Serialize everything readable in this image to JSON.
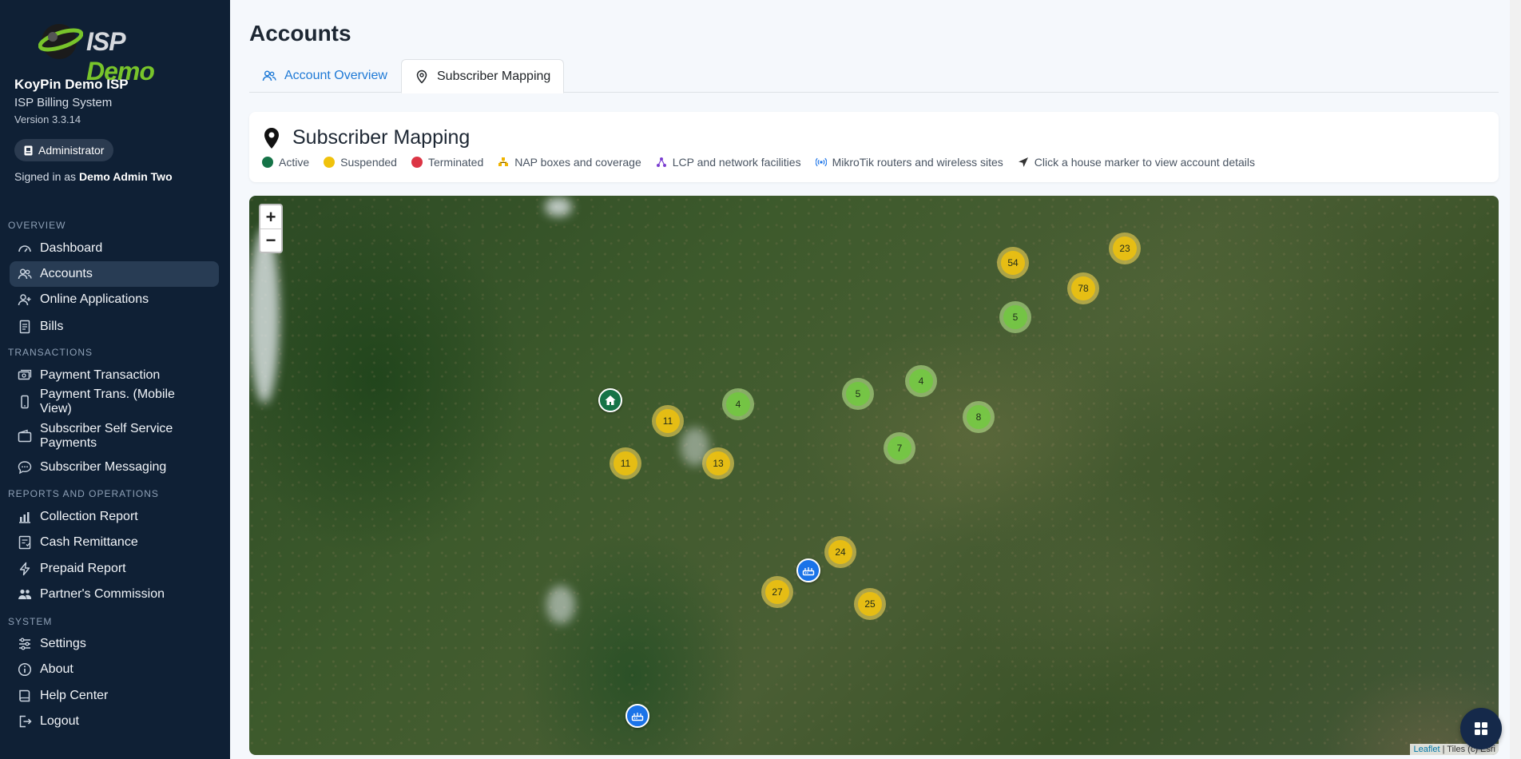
{
  "brand": {
    "logo_part1": "ISP",
    "logo_part2": "Demo"
  },
  "sidebar": {
    "org_name": "KoyPin Demo ISP",
    "system_name": "ISP Billing System",
    "version": "Version 3.3.14",
    "role": "Administrator",
    "signed_prefix": "Signed in as",
    "signed_user": "Demo Admin Two",
    "sections": {
      "overview": "OVERVIEW",
      "transactions": "TRANSACTIONS",
      "reports": "REPORTS AND OPERATIONS",
      "system": "SYSTEM"
    },
    "items": {
      "dashboard": "Dashboard",
      "accounts": "Accounts",
      "online_applications": "Online Applications",
      "bills": "Bills",
      "payment_transaction": "Payment Transaction",
      "payment_mobile": "Payment Trans. (Mobile View)",
      "self_service": "Subscriber Self Service Payments",
      "messaging": "Subscriber Messaging",
      "collection_report": "Collection Report",
      "cash_remittance": "Cash Remittance",
      "prepaid_report": "Prepaid Report",
      "partners_commission": "Partner's Commission",
      "settings": "Settings",
      "about": "About",
      "help_center": "Help Center",
      "logout": "Logout"
    }
  },
  "page": {
    "title": "Accounts",
    "tabs": {
      "overview": "Account Overview",
      "mapping": "Subscriber Mapping"
    }
  },
  "mapping_card": {
    "title": "Subscriber Mapping",
    "legend": {
      "active": "Active",
      "suspended": "Suspended",
      "terminated": "Terminated",
      "nap": "NAP boxes and coverage",
      "lcp": "LCP and network facilities",
      "mikrotik": "MikroTik routers and wireless sites",
      "hint": "Click a house marker to view account details"
    },
    "colors": {
      "active": "#157347",
      "suspended": "#f0c20c",
      "terminated": "#dc3545",
      "nap": "#f0b400",
      "lcp": "#7b3fd0",
      "mikrotik": "#1a73e8"
    }
  },
  "map": {
    "zoom_in": "+",
    "zoom_out": "−",
    "clusters": {
      "c54": "54",
      "c23": "23",
      "c78": "78",
      "c5a": "5",
      "c4a": "4",
      "c5b": "5",
      "c4b": "4",
      "c8": "8",
      "c11a": "11",
      "c11b": "11",
      "c13": "13",
      "c7": "7",
      "c24": "24",
      "c27": "27",
      "c25": "25"
    },
    "attribution_link": "Leaflet",
    "attribution_text": "| Tiles (c) Esri"
  }
}
